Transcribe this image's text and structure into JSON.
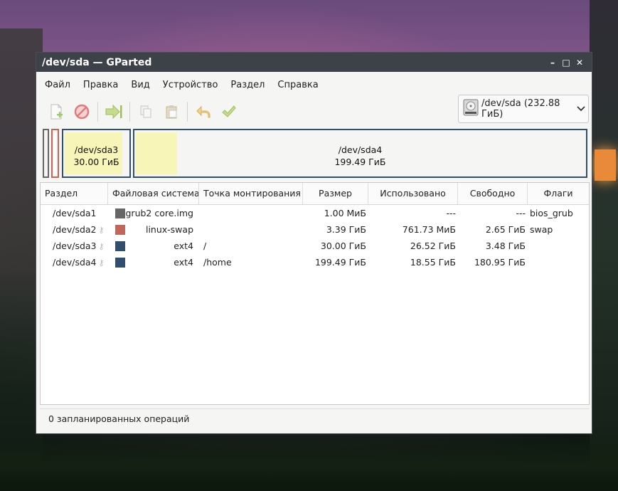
{
  "window": {
    "title": "/dev/sda — GParted",
    "controls": {
      "minimize": "–",
      "maximize": "□",
      "close": "✕"
    }
  },
  "menu": [
    "Файл",
    "Правка",
    "Вид",
    "Устройство",
    "Раздел",
    "Справка"
  ],
  "toolbar": {
    "icons": [
      "new-partition-icon",
      "delete-icon",
      "resize-move-icon",
      "copy-icon",
      "paste-icon",
      "undo-icon",
      "apply-icon"
    ]
  },
  "device": {
    "label": "/dev/sda (232.88 ГиБ)"
  },
  "diskmap": {
    "sda3": {
      "name": "/dev/sda3",
      "size": "30.00 ГиБ"
    },
    "sda4": {
      "name": "/dev/sda4",
      "size": "199.49 ГиБ"
    }
  },
  "columns": [
    "Раздел",
    "Файловая система",
    "Точка монтирования",
    "Размер",
    "Использовано",
    "Свободно",
    "Флаги"
  ],
  "rows": [
    {
      "partition": "/dev/sda1",
      "locked": false,
      "fs": "grub2 core.img",
      "color": "#666666",
      "mount": "",
      "size": "1.00 МиБ",
      "used": "---",
      "free": "---",
      "flags": "bios_grub"
    },
    {
      "partition": "/dev/sda2",
      "locked": true,
      "fs": "linux-swap",
      "color": "#c1665a",
      "mount": "",
      "size": "3.39 ГиБ",
      "used": "761.73 МиБ",
      "free": "2.65 ГиБ",
      "flags": "swap"
    },
    {
      "partition": "/dev/sda3",
      "locked": true,
      "fs": "ext4",
      "color": "#314e6c",
      "mount": "/",
      "size": "30.00 ГиБ",
      "used": "26.52 ГиБ",
      "free": "3.48 ГиБ",
      "flags": ""
    },
    {
      "partition": "/dev/sda4",
      "locked": true,
      "fs": "ext4",
      "color": "#314e6c",
      "mount": "/home",
      "size": "199.49 ГиБ",
      "used": "18.55 ГиБ",
      "free": "180.95 ГиБ",
      "flags": ""
    }
  ],
  "status": "0 запланированных операций",
  "colors": {
    "ext4": "#314e6c",
    "swap": "#c1665a",
    "grub": "#666666",
    "used_fill": "#f8f5b8"
  }
}
